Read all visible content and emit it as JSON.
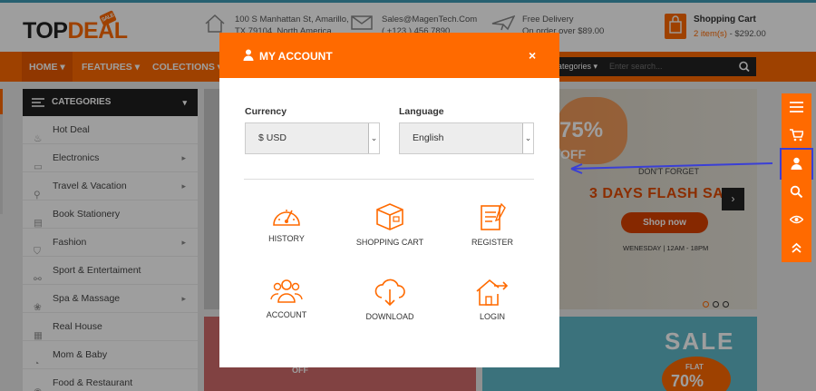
{
  "header": {
    "logo_top": "TOP",
    "logo_deal": "DEAL",
    "logo_tag": "SALE",
    "address_line1": "100 S Manhattan St, Amarillo,",
    "address_line2": "TX 79104, North America",
    "email": "Sales@MagenTech.Com",
    "phone": "( +123 ) 456 7890",
    "delivery_title": "Free Delivery",
    "delivery_sub": "On order over $89.00",
    "cart_title": "Shopping Cart",
    "cart_items": "2 item(s)",
    "cart_total": " - $292.00"
  },
  "nav": {
    "home": "HOME",
    "features": "FEATURES",
    "collections": "COLECTIONS",
    "search_categories": "Categories",
    "search_placeholder": "Enter search..."
  },
  "categories": {
    "heading": "CATEGORIES",
    "items": [
      {
        "label": "Hot Deal",
        "arrow": false
      },
      {
        "label": "Electronics",
        "arrow": true
      },
      {
        "label": "Travel & Vacation",
        "arrow": true
      },
      {
        "label": "Book Stationery",
        "arrow": false
      },
      {
        "label": "Fashion",
        "arrow": true
      },
      {
        "label": "Sport & Entertaiment",
        "arrow": false
      },
      {
        "label": "Spa & Massage",
        "arrow": true
      },
      {
        "label": "Real House",
        "arrow": false
      },
      {
        "label": "Mom & Baby",
        "arrow": false
      },
      {
        "label": "Food & Restaurant",
        "arrow": false
      }
    ]
  },
  "banner": {
    "percent": "75%",
    "off": "OFF",
    "dont_forget": "DON'T FORGET",
    "flash": "3 DAYS FLASH SA",
    "shop_now": "Shop now",
    "hours": "WENESDAY  |  12AM - 18PM",
    "b1_text": "OFF",
    "sale": "SALE",
    "flat": "FLAT",
    "flat_value": "70%"
  },
  "modal": {
    "title": "MY ACCOUNT",
    "close": "×",
    "currency_label": "Currency",
    "currency_value": "$ USD",
    "language_label": "Language",
    "language_value": "English",
    "tiles": {
      "history": "HISTORY",
      "cart": "SHOPPING CART",
      "register": "REGISTER",
      "account": "ACCOUNT",
      "download": "DOWNLOAD",
      "login": "LOGIN"
    }
  },
  "icons": {
    "toolbar": [
      "menu-icon",
      "cart-icon",
      "user-icon",
      "search-icon",
      "eye-icon",
      "chevron-up-icon"
    ]
  },
  "colors": {
    "brand": "#ff6a00",
    "dark": "#1f1f1f",
    "highlight": "#3a3fd6"
  }
}
